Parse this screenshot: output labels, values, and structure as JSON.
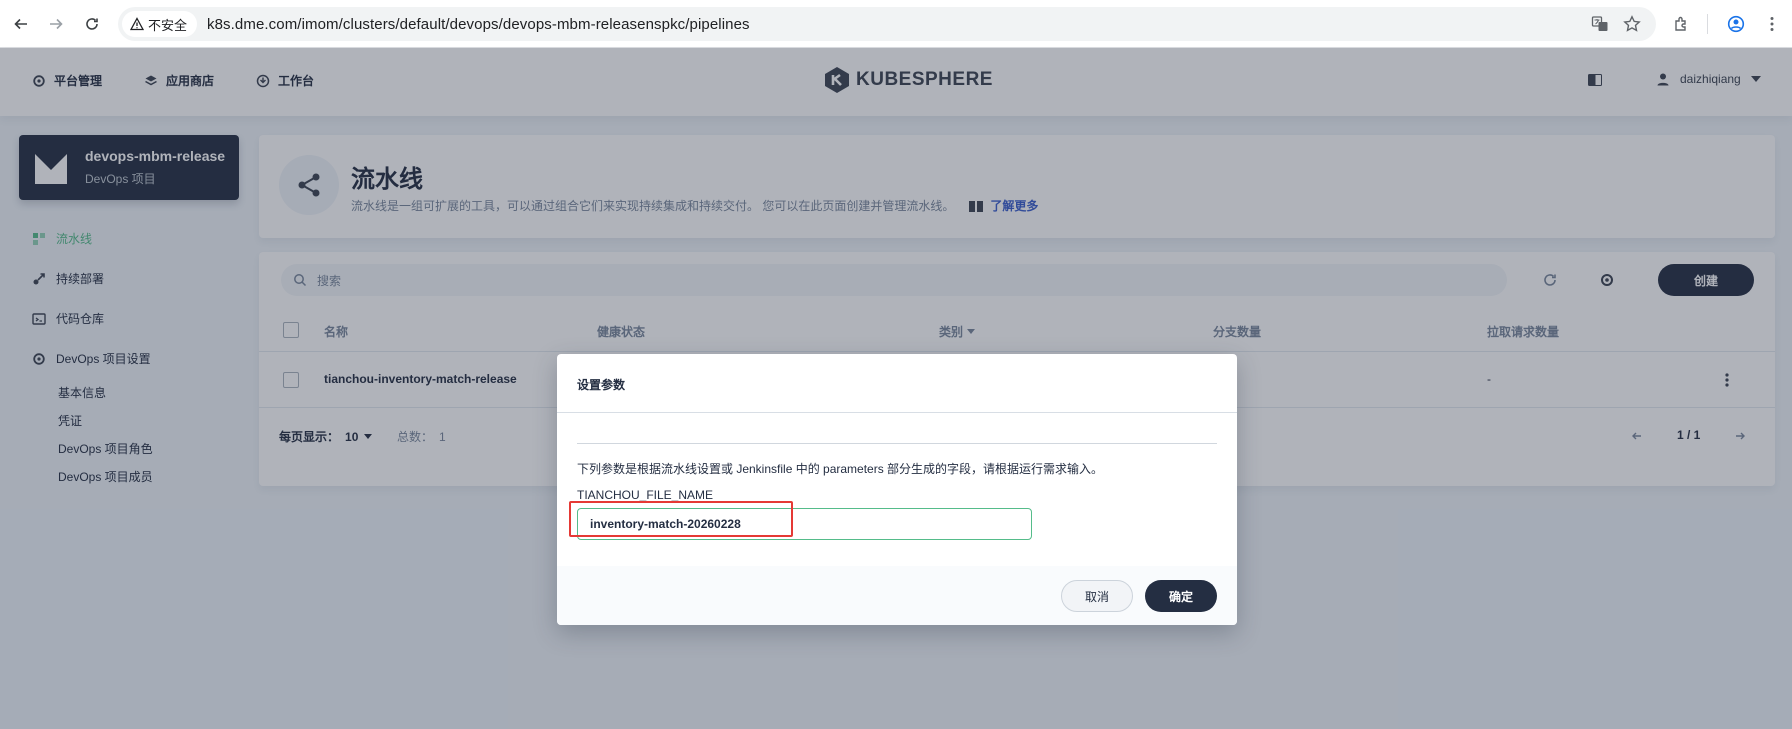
{
  "browser": {
    "security_label": "不安全",
    "url": "k8s.dme.com/imom/clusters/default/devops/devops-mbm-releasenspkc/pipelines"
  },
  "topbar": {
    "nav": [
      {
        "label": "平台管理",
        "icon": "gear-icon"
      },
      {
        "label": "应用商店",
        "icon": "app-store-icon"
      },
      {
        "label": "工作台",
        "icon": "workbench-icon"
      }
    ],
    "logo_text": "KUBESPHERE",
    "username": "daizhiqiang"
  },
  "sidebar": {
    "project_name": "devops-mbm-release",
    "project_type": "DevOps 项目",
    "items": [
      {
        "label": "流水线",
        "icon": "pipeline-icon",
        "active": true
      },
      {
        "label": "持续部署",
        "icon": "deploy-icon"
      },
      {
        "label": "代码仓库",
        "icon": "repository-icon"
      },
      {
        "label": "DevOps 项目设置",
        "icon": "gear-icon"
      }
    ],
    "sub_items": [
      "基本信息",
      "凭证",
      "DevOps 项目角色",
      "DevOps 项目成员"
    ]
  },
  "header": {
    "title": "流水线",
    "description": "流水线是一组可扩展的工具，可以通过组合它们来实现持续集成和持续交付。 您可以在此页面创建并管理流水线。",
    "learn_more": "了解更多"
  },
  "toolbar": {
    "search_placeholder": "搜索",
    "create_label": "创建"
  },
  "table": {
    "columns": [
      "名称",
      "健康状态",
      "类别",
      "分支数量",
      "拉取请求数量"
    ],
    "rows": [
      {
        "name": "tianchou-inventory-match-release",
        "pull_requests": "-"
      }
    ]
  },
  "footer": {
    "per_page_label": "每页显示：",
    "per_page_value": "10",
    "total_label": "总数：",
    "total_value": "1",
    "page_indicator": "1 / 1"
  },
  "modal": {
    "title": "设置参数",
    "description": "下列参数是根据流水线设置或 Jenkinsfile 中的 parameters 部分生成的字段，请根据运行需求输入。",
    "param_name": "TIANCHOU_FILE_NAME",
    "param_value": "inventory-match-20260228",
    "cancel_label": "取消",
    "ok_label": "确定"
  },
  "colors": {
    "accent_green": "#55bc8a",
    "dark": "#242e42",
    "highlight_red": "#e53935"
  }
}
